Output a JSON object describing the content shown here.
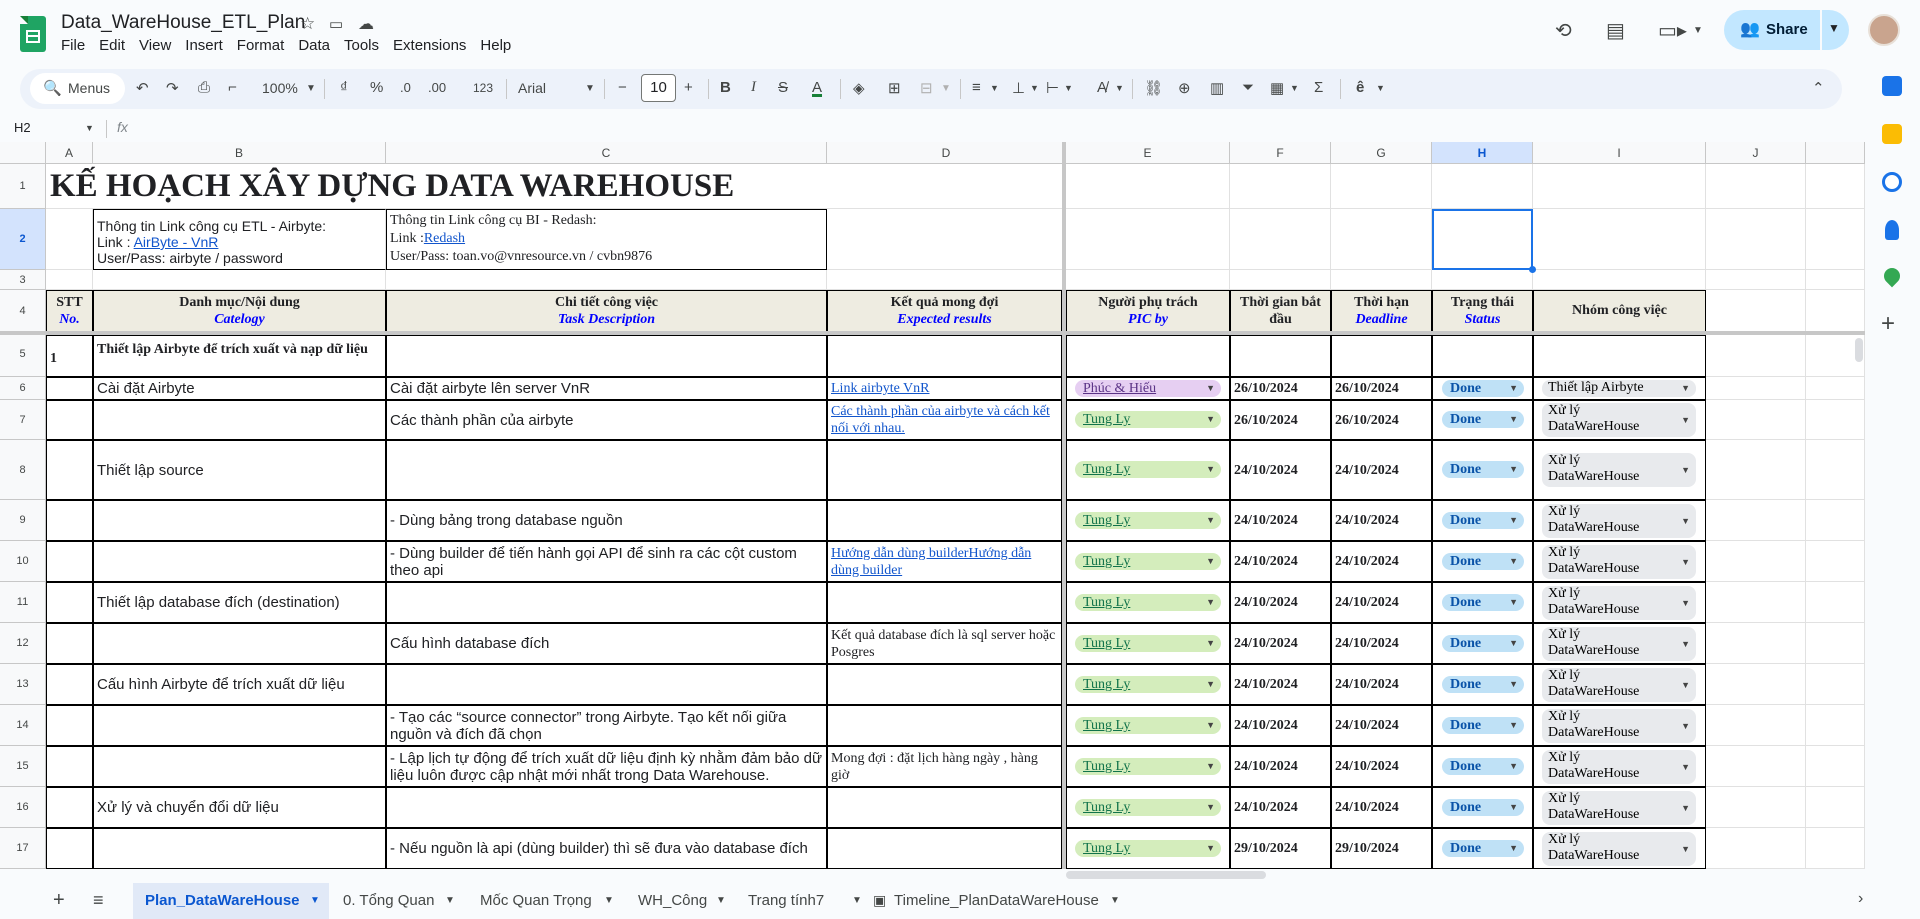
{
  "doc": {
    "title": "Data_WareHouse_ETL_Plan"
  },
  "menu": [
    "File",
    "Edit",
    "View",
    "Insert",
    "Format",
    "Data",
    "Tools",
    "Extensions",
    "Help"
  ],
  "share_label": "Share",
  "toolbar": {
    "menus": "Menus",
    "zoom": "100%",
    "currency": "₫",
    "percent": "%",
    "dec_less": ".0",
    "dec_more": ".00",
    "format_123": "123",
    "font": "Arial",
    "font_size": "10"
  },
  "formula": {
    "cell_ref": "H2",
    "fx": "fx"
  },
  "columns": [
    "A",
    "B",
    "C",
    "D",
    "E",
    "F",
    "G",
    "H",
    "I",
    "J"
  ],
  "rows": [
    "1",
    "2",
    "3",
    "4",
    "5",
    "6",
    "7",
    "8",
    "9",
    "10",
    "11",
    "12",
    "13",
    "14",
    "15",
    "16",
    "17"
  ],
  "sheet": {
    "title": "KẾ HOẠCH XÂY DỰNG DATA WAREHOUSE",
    "b2": {
      "line1": "Thông tin Link công cụ ETL - Airbyte:",
      "line2_prefix": "Link : ",
      "line2_link": "AirByte - VnR",
      "line3": "User/Pass: airbyte / password"
    },
    "c2": {
      "line1": "Thông tin Link công cụ BI - Redash:",
      "line2_prefix": "Link :",
      "line2_link": "Redash",
      "line3": "User/Pass: toan.vo@vnresource.vn / cvbn9876"
    },
    "headers": {
      "a": {
        "vi": "STT",
        "en": "No."
      },
      "b": {
        "vi": "Danh mục/Nội dung",
        "en": "Catelogy"
      },
      "c": {
        "vi": "Chi tiết công việc",
        "en": "Task Description"
      },
      "d": {
        "vi": "Kết quả mong đợi",
        "en": "Expected results"
      },
      "e": {
        "vi": "Người phụ trách",
        "en": "PIC by"
      },
      "f": {
        "vi": "Thời gian bắt đầu"
      },
      "g": {
        "vi": "Thời hạn",
        "en": "Deadline"
      },
      "h": {
        "vi": "Trạng thái",
        "en": "Status"
      },
      "i": {
        "vi": "Nhóm công việc"
      }
    },
    "r5": {
      "no": "1",
      "category": "Thiết lập Airbyte để trích xuất và nạp dữ liệu"
    },
    "data_rows": [
      {
        "b": "Cài đặt Airbyte",
        "c": "Cài đặt airbyte lên server VnR",
        "d": "Link airbyte VnR",
        "d_link": true,
        "pic": "Phúc & Hiếu",
        "start": "26/10/2024",
        "deadline": "26/10/2024",
        "status": "Done",
        "group": "Thiết lập Airbyte"
      },
      {
        "b": "",
        "c": "Các thành phần của airbyte",
        "d": "Các thành phần của airbyte và cách kết nối với nhau.",
        "d_link": true,
        "pic": "Tung Ly",
        "start": "26/10/2024",
        "deadline": "26/10/2024",
        "status": "Done",
        "group": "Xử lý DataWareHouse"
      },
      {
        "b": "Thiết lập source",
        "c": "",
        "d": "",
        "d_link": false,
        "pic": "Tung Ly",
        "start": "24/10/2024",
        "deadline": "24/10/2024",
        "status": "Done",
        "group": "Xử lý DataWareHouse"
      },
      {
        "b": "",
        "c": "- Dùng bảng trong database nguồn",
        "d": "",
        "d_link": false,
        "pic": "Tung Ly",
        "start": "24/10/2024",
        "deadline": "24/10/2024",
        "status": "Done",
        "group": "Xử lý DataWareHouse"
      },
      {
        "b": "",
        "c": "- Dùng builder  để tiến hành gọi API để sinh ra các cột custom theo api",
        "d": "Hướng dẫn dùng builderHướng dẫn dùng builder",
        "d_link": true,
        "pic": "Tung Ly",
        "start": "24/10/2024",
        "deadline": "24/10/2024",
        "status": "Done",
        "group": "Xử lý DataWareHouse"
      },
      {
        "b": "Thiết lập database đích (destination)",
        "c": "",
        "d": "",
        "d_link": false,
        "pic": "Tung Ly",
        "start": "24/10/2024",
        "deadline": "24/10/2024",
        "status": "Done",
        "group": "Xử lý DataWareHouse"
      },
      {
        "b": "",
        "c": "Cấu hình database đích",
        "d": "Kết quả database đích là sql server hoặc Posgres",
        "d_link": false,
        "pic": "Tung Ly",
        "start": "24/10/2024",
        "deadline": "24/10/2024",
        "status": "Done",
        "group": "Xử lý DataWareHouse"
      },
      {
        "b": "Cấu hình Airbyte để trích xuất dữ liệu",
        "c": "",
        "d": "",
        "d_link": false,
        "pic": "Tung Ly",
        "start": "24/10/2024",
        "deadline": "24/10/2024",
        "status": "Done",
        "group": "Xử lý DataWareHouse"
      },
      {
        "b": "",
        "c": "- Tạo các “source connector” trong Airbyte. Tạo kết nối giữa nguồn và đích đã chọn",
        "d": "",
        "d_link": false,
        "pic": "Tung Ly",
        "start": "24/10/2024",
        "deadline": "24/10/2024",
        "status": "Done",
        "group": "Xử lý DataWareHouse"
      },
      {
        "b": "",
        "c": "- Lập lịch tự động để trích xuất dữ liệu định kỳ nhằm đảm bảo dữ liệu luôn được cập nhật mới nhất trong Data Warehouse.",
        "d": "Mong đợi : đặt lịch hàng ngày , hàng giờ",
        "d_link": false,
        "pic": "Tung Ly",
        "start": "24/10/2024",
        "deadline": "24/10/2024",
        "status": "Done",
        "group": "Xử lý DataWareHouse"
      },
      {
        "b": "Xử lý và chuyển đổi dữ liệu",
        "c": "",
        "d": "",
        "d_link": false,
        "pic": "Tung Ly",
        "start": "24/10/2024",
        "deadline": "24/10/2024",
        "status": "Done",
        "group": "Xử lý DataWareHouse"
      },
      {
        "b": "",
        "c": "- Nếu nguồn là api (dùng builder) thì sẽ đưa vào database đích",
        "d": "",
        "d_link": false,
        "pic": "Tung Ly",
        "start": "29/10/2024",
        "deadline": "29/10/2024",
        "status": "Done",
        "group": "Xử lý DataWareHouse"
      }
    ]
  },
  "tabs": [
    "Plan_DataWareHouse",
    "0. Tổng Quan",
    "Mốc Quan Trọng",
    "WH_Công",
    "Trang tính7",
    "Timeline_PlanDataWareHouse"
  ],
  "colors": {
    "accent": "#0b57d0",
    "share_bg": "#c2e7ff",
    "header_fill": "#eeece1",
    "pic_chip": "#d4edbc",
    "status_chip": "#bfe1f6"
  }
}
